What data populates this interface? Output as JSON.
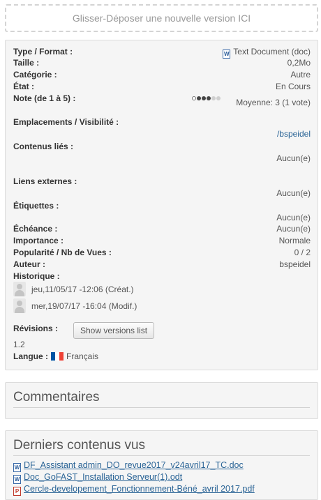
{
  "dropzone": {
    "text": "Glisser-Déposer une nouvelle version ICI"
  },
  "properties": {
    "type_label": "Type / Format :",
    "type_value": "Text Document (doc)",
    "size_label": "Taille :",
    "size_value": "0,2Mo",
    "category_label": "Catégorie :",
    "category_value": "Autre",
    "state_label": "État :",
    "state_value": "En Cours",
    "rating_label": "Note (de 1 à 5) :",
    "rating_value": 3,
    "rating_max": 5,
    "rating_text": "Moyenne: 3 (1 vote)",
    "locations_label": "Emplacements / Visibilité :",
    "locations_value": "/bspeidel",
    "related_label": "Contenus liés :",
    "related_value": "Aucun(e)",
    "external_label": "Liens externes :",
    "external_value": "Aucun(e)",
    "tags_label": "Étiquettes :",
    "tags_value": "Aucun(e)",
    "deadline_label": "Échéance :",
    "deadline_value": "Aucun(e)",
    "importance_label": "Importance :",
    "importance_value": "Normale",
    "popularity_label": "Popularité / Nb de Vues :",
    "popularity_value": "0 / 2",
    "author_label": "Auteur :",
    "author_value": "bspeidel",
    "history_label": "Historique :",
    "history": [
      {
        "text": "jeu,11/05/17 -12:06 (Créat.)"
      },
      {
        "text": "mer,19/07/17 -16:04 (Modif.)"
      }
    ],
    "revisions_label": "Révisions :",
    "revisions_button": "Show versions list",
    "version": "1.2",
    "language_label": "Langue :",
    "language_value": "Français",
    "flag_colors": [
      "#0055A4",
      "#FFFFFF",
      "#EF4135"
    ]
  },
  "comments": {
    "title": "Commentaires"
  },
  "recent": {
    "title": "Derniers contenus vus",
    "items": [
      {
        "name": "DF_Assistant admin_DO_revue2017_v24avril17_TC.doc",
        "icon": "word-doc-icon"
      },
      {
        "name": "Doc_GoFAST_Installation Serveur(1).odt",
        "icon": "word-doc-icon"
      },
      {
        "name": "Cercle-developement_Fonctionnement-Béné_avril 2017.pdf",
        "icon": "pdf-icon"
      }
    ]
  },
  "colors": {
    "link": "#2a6496",
    "panel_bg": "#f5f5f5",
    "border": "#dcdcdc"
  }
}
